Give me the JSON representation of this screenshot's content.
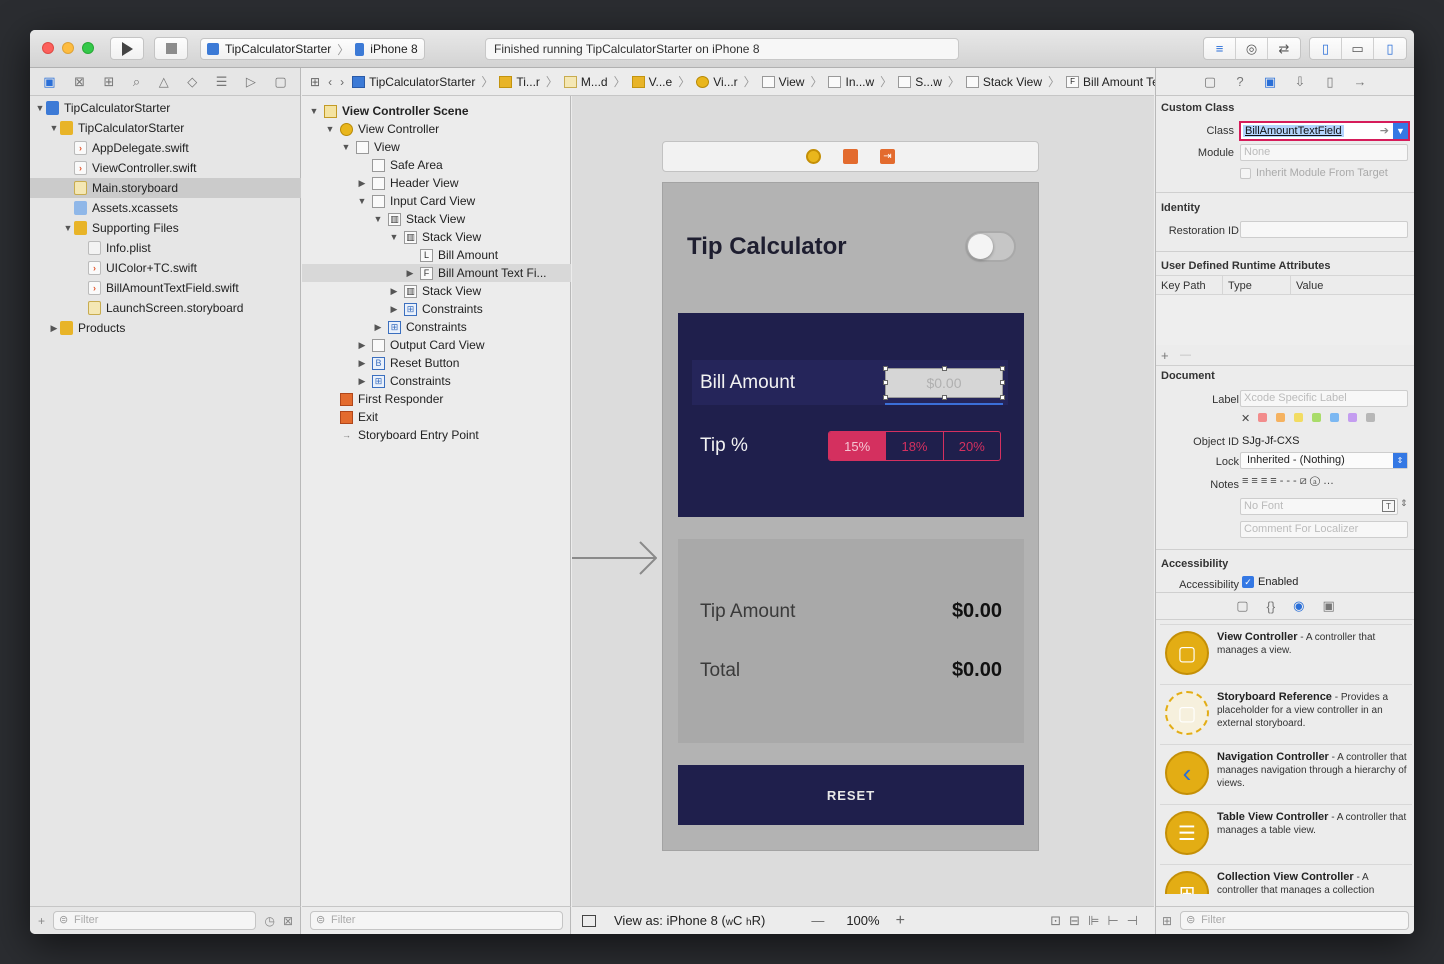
{
  "toolbar": {
    "scheme": "TipCalculatorStarter",
    "device": "iPhone 8",
    "status": "Finished running TipCalculatorStarter on iPhone 8",
    "run_icon": "play-icon",
    "stop_icon": "stop-icon",
    "colors": {
      "close": "#fc605c",
      "minimize": "#fdbc40",
      "zoom": "#34c84a",
      "accent": "#2a6fd8"
    }
  },
  "navigator": {
    "items": [
      {
        "label": "TipCalculatorStarter",
        "icon": "project-icon",
        "depth": 0,
        "disclosure": "▼"
      },
      {
        "label": "TipCalculatorStarter",
        "icon": "folder-icon",
        "depth": 1,
        "disclosure": "▼"
      },
      {
        "label": "AppDelegate.swift",
        "icon": "swift-file-icon",
        "depth": 2,
        "disclosure": ""
      },
      {
        "label": "ViewController.swift",
        "icon": "swift-file-icon",
        "depth": 2,
        "disclosure": ""
      },
      {
        "label": "Main.storyboard",
        "icon": "storyboard-file-icon",
        "depth": 2,
        "disclosure": "",
        "selected": true
      },
      {
        "label": "Assets.xcassets",
        "icon": "assets-icon",
        "depth": 2,
        "disclosure": ""
      },
      {
        "label": "Supporting Files",
        "icon": "folder-icon",
        "depth": 2,
        "disclosure": "▼"
      },
      {
        "label": "Info.plist",
        "icon": "plist-file-icon",
        "depth": 3,
        "disclosure": ""
      },
      {
        "label": "UIColor+TC.swift",
        "icon": "swift-file-icon",
        "depth": 3,
        "disclosure": ""
      },
      {
        "label": "BillAmountTextField.swift",
        "icon": "swift-file-icon",
        "depth": 3,
        "disclosure": ""
      },
      {
        "label": "LaunchScreen.storyboard",
        "icon": "storyboard-file-icon",
        "depth": 3,
        "disclosure": ""
      },
      {
        "label": "Products",
        "icon": "folder-icon",
        "depth": 1,
        "disclosure": "▶"
      }
    ],
    "filter_placeholder": "Filter"
  },
  "jumpbar": {
    "crumbs": [
      "TipCalculatorStarter",
      "Ti...r",
      "M...d",
      "V...e",
      "Vi...r",
      "View",
      "In...w",
      "S...w",
      "Stack View",
      "Bill Amount Text Field"
    ]
  },
  "outline": {
    "items": [
      {
        "label": "View Controller Scene",
        "icon": "scene-icon",
        "depth": 0,
        "disclosure": "▼",
        "bold": true
      },
      {
        "label": "View Controller",
        "icon": "view-controller-icon",
        "depth": 1,
        "disclosure": "▼"
      },
      {
        "label": "View",
        "icon": "view-icon",
        "depth": 2,
        "disclosure": "▼"
      },
      {
        "label": "Safe Area",
        "icon": "view-icon",
        "depth": 3,
        "disclosure": ""
      },
      {
        "label": "Header View",
        "icon": "view-icon",
        "depth": 3,
        "disclosure": "▶"
      },
      {
        "label": "Input Card View",
        "icon": "view-icon",
        "depth": 3,
        "disclosure": "▼"
      },
      {
        "label": "Stack View",
        "icon": "stack-view-icon",
        "depth": 4,
        "disclosure": "▼"
      },
      {
        "label": "Stack View",
        "icon": "stack-view-icon",
        "depth": 5,
        "disclosure": "▼"
      },
      {
        "label": "Bill Amount",
        "icon": "label-icon",
        "glyph": "L",
        "depth": 6,
        "disclosure": ""
      },
      {
        "label": "Bill Amount Text Fi...",
        "icon": "text-field-icon",
        "glyph": "F",
        "depth": 6,
        "disclosure": "▶",
        "selected": true
      },
      {
        "label": "Stack View",
        "icon": "stack-view-icon",
        "depth": 5,
        "disclosure": "▶"
      },
      {
        "label": "Constraints",
        "icon": "constraints-icon",
        "depth": 5,
        "disclosure": "▶"
      },
      {
        "label": "Constraints",
        "icon": "constraints-icon",
        "depth": 4,
        "disclosure": "▶"
      },
      {
        "label": "Output Card View",
        "icon": "view-icon",
        "depth": 3,
        "disclosure": "▶"
      },
      {
        "label": "Reset Button",
        "icon": "button-icon",
        "glyph": "B",
        "depth": 3,
        "disclosure": "▶"
      },
      {
        "label": "Constraints",
        "icon": "constraints-icon",
        "depth": 3,
        "disclosure": "▶"
      },
      {
        "label": "First Responder",
        "icon": "first-responder-icon",
        "depth": 1,
        "disclosure": ""
      },
      {
        "label": "Exit",
        "icon": "exit-icon",
        "depth": 1,
        "disclosure": ""
      },
      {
        "label": "Storyboard Entry Point",
        "icon": "entry-point-icon",
        "depth": 1,
        "disclosure": ""
      }
    ],
    "filter_placeholder": "Filter"
  },
  "canvas": {
    "app_title": "Tip Calculator",
    "bill_label": "Bill Amount",
    "bill_placeholder": "$0.00",
    "tip_label": "Tip %",
    "tip_options": [
      "15%",
      "18%",
      "20%"
    ],
    "tip_selected": 0,
    "tip_amount_label": "Tip Amount",
    "tip_amount_value": "$0.00",
    "total_label": "Total",
    "total_value": "$0.00",
    "reset_label": "RESET",
    "colors": {
      "card": "#1f1f4c",
      "accent": "#d4305f"
    }
  },
  "canvas_bar": {
    "view_as_prefix": "View as: iPhone 8 (",
    "size_class_w": "w",
    "size_class_c": "C",
    "size_class_h": "h",
    "size_class_r": "R",
    "view_as_suffix": ")",
    "minus": "—",
    "zoom": "100%",
    "plus": "+"
  },
  "inspector": {
    "custom_class": {
      "title": "Custom Class",
      "class_label": "Class",
      "class_value": "BillAmountTextField",
      "module_label": "Module",
      "module_value": "None",
      "inherit_label": "Inherit Module From Target"
    },
    "identity": {
      "title": "Identity",
      "restoration_label": "Restoration ID"
    },
    "runtime": {
      "title": "User Defined Runtime Attributes",
      "columns": [
        "Key Path",
        "Type",
        "Value"
      ],
      "add": "+",
      "remove": "—"
    },
    "document": {
      "title": "Document",
      "label_label": "Label",
      "label_placeholder": "Xcode Specific Label",
      "clear": "✕",
      "swatch_colors": [
        "#f28c8c",
        "#f5b260",
        "#f2dc62",
        "#a9dc6a",
        "#7cb8f2",
        "#c49df0",
        "#b7b7b7"
      ],
      "object_id_label": "Object ID",
      "object_id": "SJg-Jf-CXS",
      "lock_label": "Lock",
      "lock_value": "Inherited - (Nothing)",
      "notes_label": "Notes",
      "font_placeholder": "No Font",
      "comment_placeholder": "Comment For Localizer"
    },
    "accessibility": {
      "title": "Accessibility",
      "label": "Accessibility",
      "value": "Enabled"
    },
    "library": [
      {
        "title": "View Controller",
        "desc": " - A controller that manages a view."
      },
      {
        "title": "Storyboard Reference",
        "desc": " - Provides a placeholder for a view controller in an external storyboard."
      },
      {
        "title": "Navigation Controller",
        "desc": " - A controller that manages navigation through a hierarchy of views."
      },
      {
        "title": "Table View Controller",
        "desc": " - A controller that manages a table view."
      },
      {
        "title": "Collection View Controller",
        "desc": " - A controller that manages a collection"
      }
    ],
    "filter_placeholder": "Filter"
  }
}
